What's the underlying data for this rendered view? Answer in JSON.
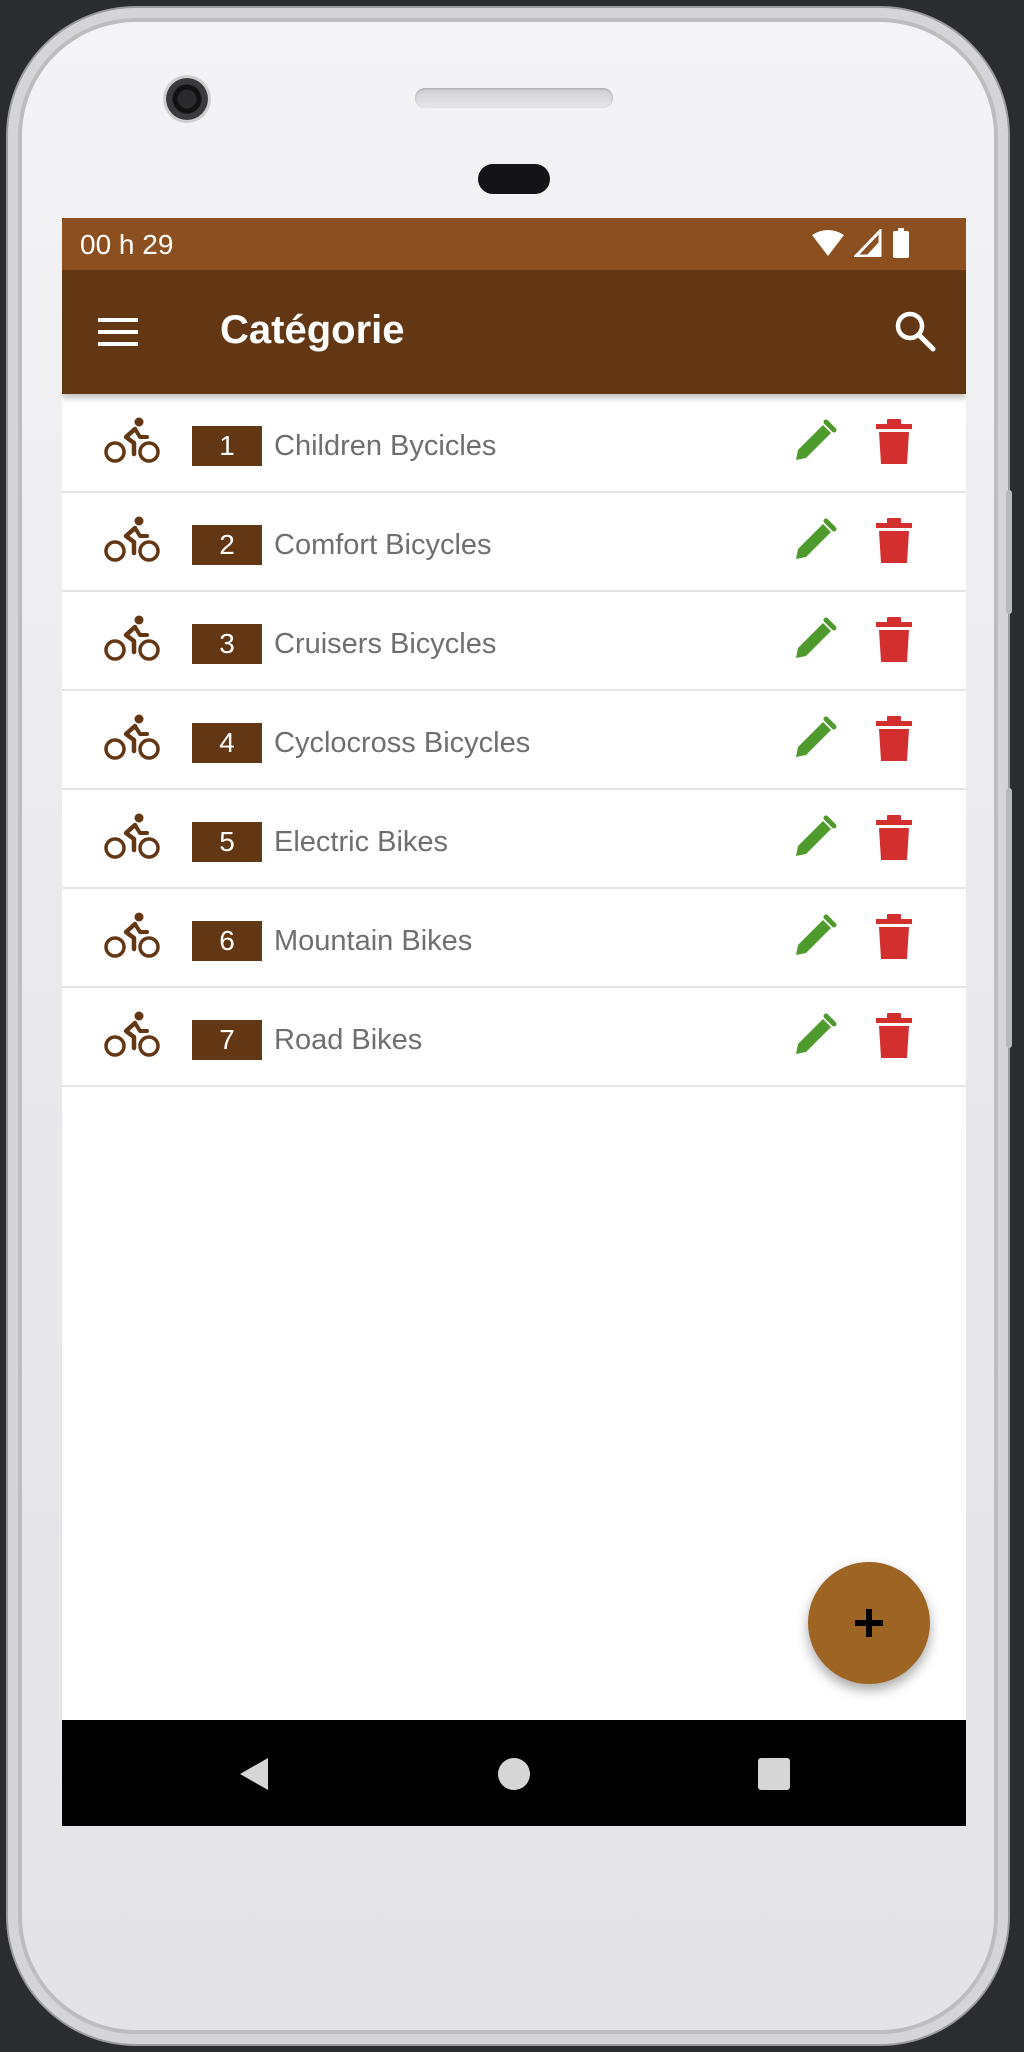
{
  "status_bar": {
    "time": "00 h 29",
    "icons": [
      "wifi-icon",
      "signal-icon",
      "battery-icon"
    ]
  },
  "app_bar": {
    "title": "Catégorie",
    "menu_icon": "hamburger-menu-icon",
    "search_icon": "search-icon"
  },
  "categories": [
    {
      "id": "1",
      "name": "Children Bycicles"
    },
    {
      "id": "2",
      "name": "Comfort Bicycles"
    },
    {
      "id": "3",
      "name": "Cruisers Bicycles"
    },
    {
      "id": "4",
      "name": "Cyclocross Bicycles"
    },
    {
      "id": "5",
      "name": "Electric Bikes"
    },
    {
      "id": "6",
      "name": "Mountain Bikes"
    },
    {
      "id": "7",
      "name": "Road Bikes"
    }
  ],
  "row_icons": {
    "leading": "bike-icon",
    "edit": "pencil-icon",
    "delete": "trash-icon"
  },
  "fab": {
    "icon": "plus-icon"
  },
  "nav_bar": {
    "icons": [
      "back-triangle-icon",
      "home-circle-icon",
      "recents-square-icon"
    ]
  },
  "colors": {
    "status_bar": "#8b4f20",
    "app_bar": "#633714",
    "badge": "#633714",
    "bike_icon": "#633714",
    "edit": "#4e9a2c",
    "delete": "#d32f2f",
    "fab": "#9e6424"
  }
}
